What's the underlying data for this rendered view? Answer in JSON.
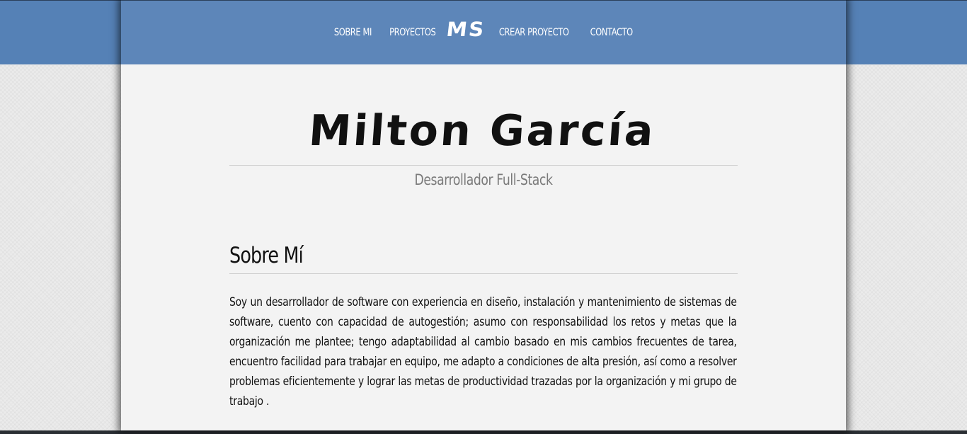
{
  "nav": {
    "links": {
      "about": "SOBRE MI",
      "projects": "PROYECTOS",
      "create_project": "CREAR PROYECTO",
      "contact": "CONTACTO"
    },
    "logo": "MS"
  },
  "header": {
    "name": "Milton García",
    "role": "Desarrollador Full-Stack"
  },
  "about": {
    "heading": "Sobre Mí",
    "text": "Soy un desarrollador de software con experiencia en diseño, instalación y mantenimiento de sistemas de software, cuento con capacidad de autogestión; asumo con responsabilidad los retos y metas que la organización me plantee; tengo adaptabilidad al cambio basado en mis cambios frecuentes de tarea, encuentro facilidad para trabajar en equipo, me adapto a condiciones de alta presión, así como a resolver problemas eficientemente y lograr las metas de productividad trazadas por la organización y mi grupo de trabajo ."
  },
  "colors": {
    "navbar": "#5d86b9",
    "page_background": "#f3f3f3",
    "text": "#111111",
    "subtitle": "#7a7a7a"
  }
}
